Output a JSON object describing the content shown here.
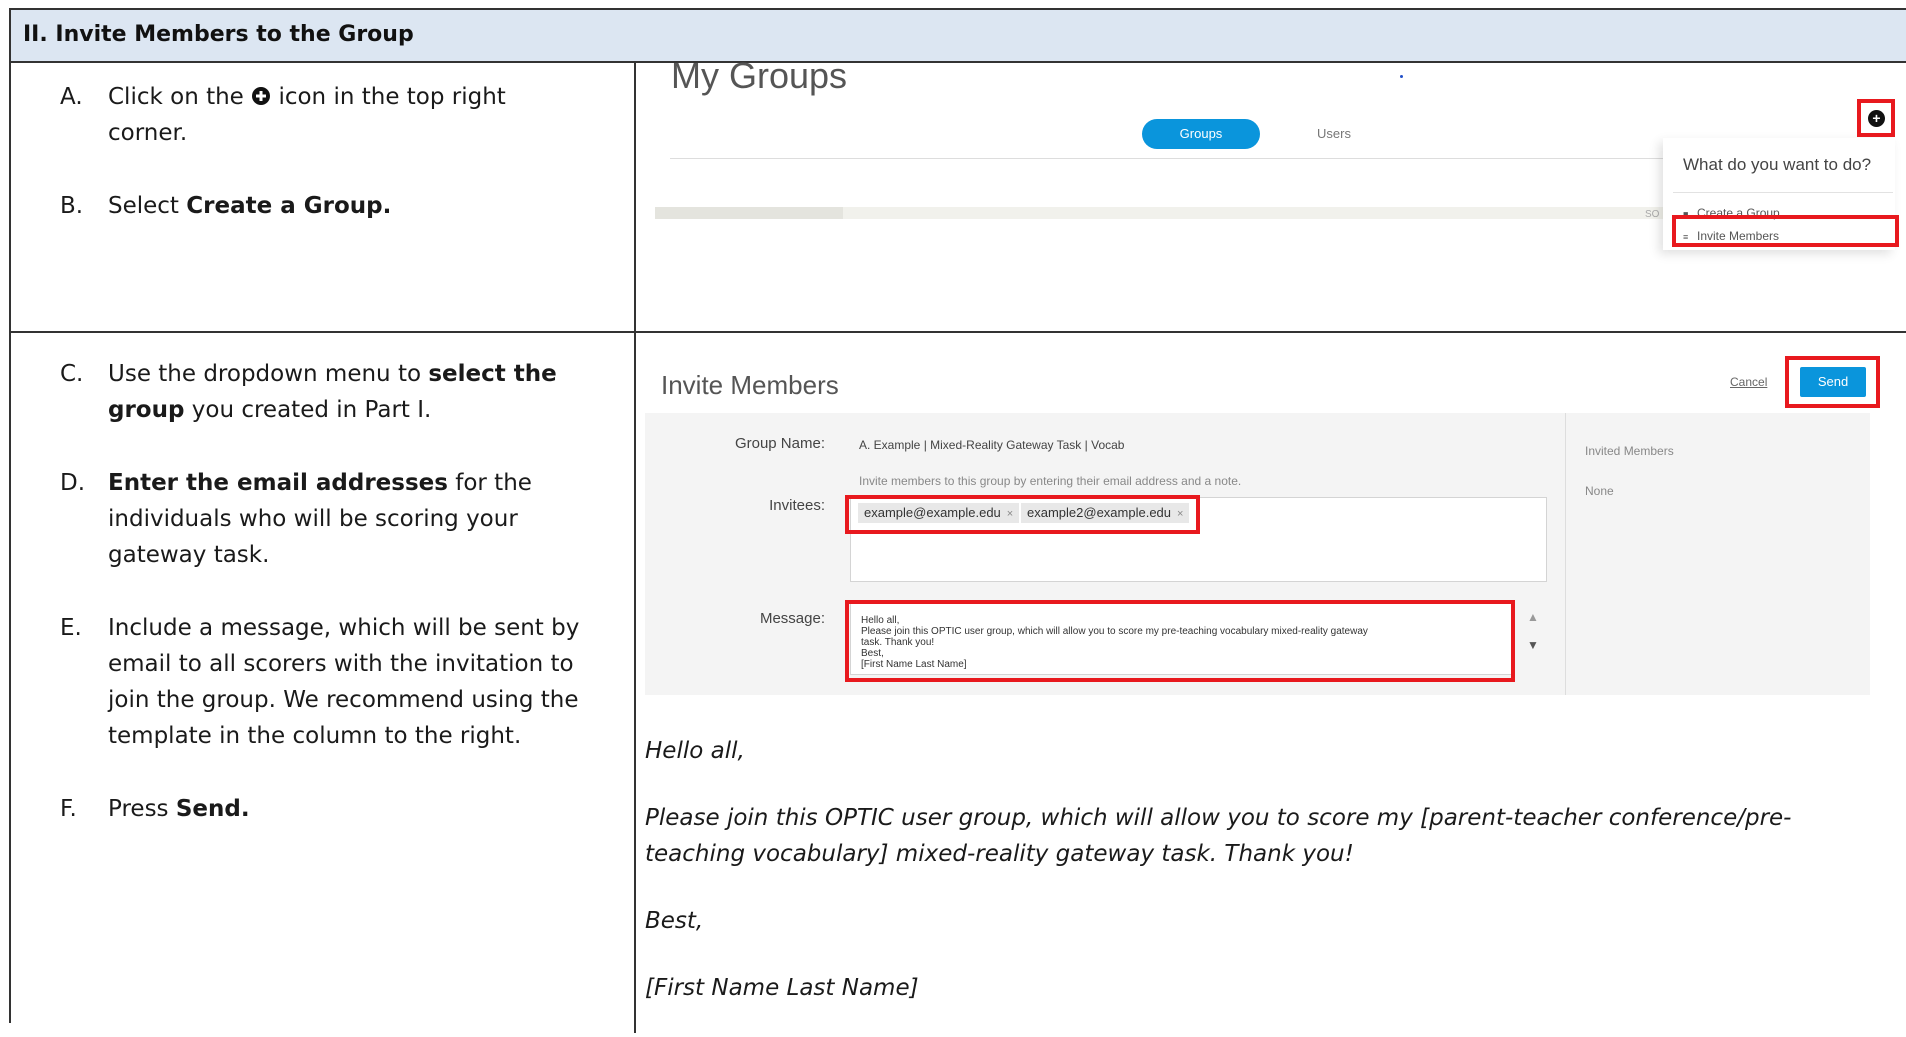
{
  "section": {
    "title": "II. Invite Members to the Group"
  },
  "steps_row1": [
    {
      "letter": "A.",
      "pre": "Click on the ",
      "icon": "plus-circle-icon",
      "post": " icon in the top right corner."
    },
    {
      "letter": "B.",
      "pre": "Select ",
      "bold": "Create a Group."
    }
  ],
  "steps_row2": [
    {
      "letter": "C.",
      "pre": "Use the dropdown menu to ",
      "bold": "select the group",
      "post": " you created in Part I."
    },
    {
      "letter": "D.",
      "bold": "Enter the email addresses",
      "post": " for the individuals who will be scoring your gateway task."
    },
    {
      "letter": "E.",
      "pre": "Include a message, which will be sent by email to all scorers with the invitation to join the group. We recommend using the template in the column to the right."
    },
    {
      "letter": "F.",
      "pre": "Press ",
      "bold": "Send."
    }
  ],
  "my_groups": {
    "title": "My Groups",
    "tab_groups": "Groups",
    "tab_users": "Users",
    "menu_title": "What do you want to do?",
    "menu_create": "Create a Group",
    "menu_invite": "Invite Members",
    "partial_text": "SO"
  },
  "invite_members": {
    "title": "Invite Members",
    "cancel": "Cancel",
    "send": "Send",
    "group_name_label": "Group Name:",
    "group_name_value": "A. Example | Mixed-Reality Gateway Task | Vocab",
    "hint": "Invite members to this group by entering their email address and a note.",
    "invitees_label": "Invitees:",
    "invitees": [
      "example@example.edu",
      "example2@example.edu"
    ],
    "message_label": "Message:",
    "message_text": "Hello all,\nPlease join this OPTIC user group, which will allow you to score my pre-teaching vocabulary mixed-reality gateway\ntask. Thank you!\nBest,\n[First Name Last Name]",
    "invited_members_label": "Invited Members",
    "invited_members_value": "None"
  },
  "template": {
    "greeting": "Hello all,",
    "body": "Please join this OPTIC user group, which will allow you to score my [parent-teacher conference/pre-teaching vocabulary] mixed-reality gateway task. Thank you!",
    "closing": "Best,",
    "signature": "[First Name Last Name]"
  },
  "colors": {
    "header_bg": "#dce6f2",
    "highlight": "#e8191e",
    "accent": "#0a95dc"
  }
}
